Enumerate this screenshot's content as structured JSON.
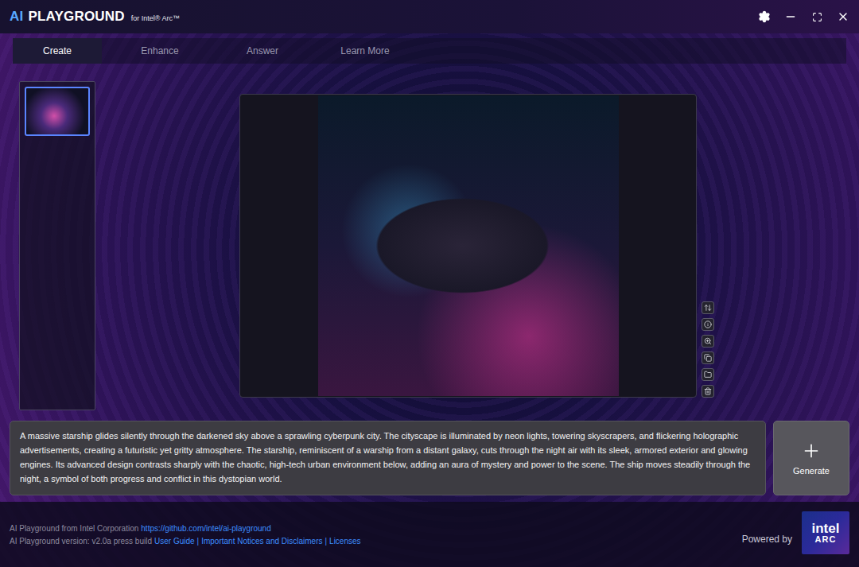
{
  "window": {
    "logo_accent": "AI",
    "logo_main": "PLAYGROUND",
    "logo_sub": "for Intel® Arc™"
  },
  "tabs": [
    {
      "label": "Create",
      "selected": true
    },
    {
      "label": "Enhance",
      "selected": false
    },
    {
      "label": "Answer",
      "selected": false
    },
    {
      "label": "Learn More",
      "selected": false
    }
  ],
  "history": [
    {
      "selected": true
    }
  ],
  "prompt": {
    "text": "A massive starship glides silently through the darkened sky above a sprawling cyberpunk city. The cityscape is illuminated by neon lights, towering skyscrapers, and flickering holographic advertisements, creating a futuristic yet gritty atmosphere. The starship, reminiscent of a warship from a distant galaxy, cuts through the night air with its sleek, armored exterior and glowing engines. Its advanced design contrasts sharply with the chaotic, high-tech urban environment below, adding an aura of mystery and power to the scene. The ship moves steadily through the night, a symbol of both progress and conflict in this dystopian world."
  },
  "generate_button": {
    "label": "Generate"
  },
  "footer": {
    "line1": "AI Playground from Intel Corporation",
    "repo_link": "https://github.com/intel/ai-playground",
    "line2": "AI Playground version: v2.0a press build",
    "links": [
      "User Guide",
      "Important Notices and Disclaimers",
      "Licenses"
    ],
    "separator": "|",
    "powered_by": "Powered by",
    "badge_top": "intel",
    "badge_bottom": "ARC"
  }
}
